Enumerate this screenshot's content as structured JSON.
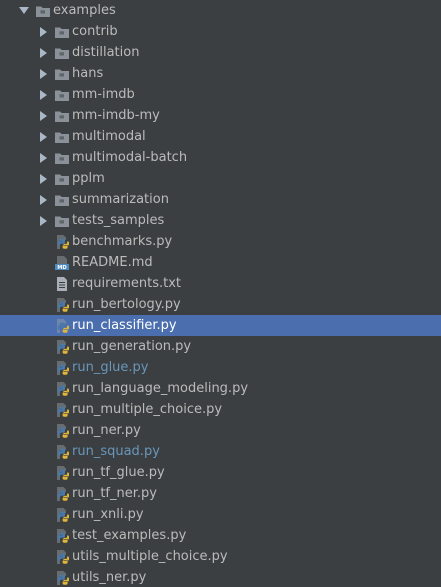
{
  "tree": {
    "root": {
      "label": "examples",
      "icon": "folder-icon",
      "expanded": true
    },
    "items": [
      {
        "label": "contrib",
        "type": "folder",
        "icon": "folder-icon"
      },
      {
        "label": "distillation",
        "type": "folder",
        "icon": "folder-icon"
      },
      {
        "label": "hans",
        "type": "folder",
        "icon": "folder-icon"
      },
      {
        "label": "mm-imdb",
        "type": "folder",
        "icon": "folder-icon"
      },
      {
        "label": "mm-imdb-my",
        "type": "folder",
        "icon": "folder-icon"
      },
      {
        "label": "multimodal",
        "type": "folder",
        "icon": "folder-icon"
      },
      {
        "label": "multimodal-batch",
        "type": "folder",
        "icon": "folder-icon"
      },
      {
        "label": "pplm",
        "type": "folder",
        "icon": "folder-icon"
      },
      {
        "label": "summarization",
        "type": "folder",
        "icon": "folder-icon"
      },
      {
        "label": "tests_samples",
        "type": "folder",
        "icon": "folder-icon"
      },
      {
        "label": "benchmarks.py",
        "type": "python",
        "icon": "python-file-icon"
      },
      {
        "label": "README.md",
        "type": "markdown",
        "icon": "markdown-file-icon",
        "icon_text": "MD"
      },
      {
        "label": "requirements.txt",
        "type": "text",
        "icon": "text-file-icon"
      },
      {
        "label": "run_bertology.py",
        "type": "python",
        "icon": "python-file-icon"
      },
      {
        "label": "run_classifier.py",
        "type": "python",
        "icon": "python-file-icon",
        "selected": true
      },
      {
        "label": "run_generation.py",
        "type": "python",
        "icon": "python-file-icon"
      },
      {
        "label": "run_glue.py",
        "type": "python",
        "icon": "python-file-icon",
        "vcs_modified": true
      },
      {
        "label": "run_language_modeling.py",
        "type": "python",
        "icon": "python-file-icon"
      },
      {
        "label": "run_multiple_choice.py",
        "type": "python",
        "icon": "python-file-icon"
      },
      {
        "label": "run_ner.py",
        "type": "python",
        "icon": "python-file-icon"
      },
      {
        "label": "run_squad.py",
        "type": "python",
        "icon": "python-file-icon",
        "vcs_modified": true
      },
      {
        "label": "run_tf_glue.py",
        "type": "python",
        "icon": "python-file-icon"
      },
      {
        "label": "run_tf_ner.py",
        "type": "python",
        "icon": "python-file-icon"
      },
      {
        "label": "run_xnli.py",
        "type": "python",
        "icon": "python-file-icon"
      },
      {
        "label": "test_examples.py",
        "type": "python",
        "icon": "python-file-icon"
      },
      {
        "label": "utils_multiple_choice.py",
        "type": "python",
        "icon": "python-file-icon"
      },
      {
        "label": "utils_ner.py",
        "type": "python",
        "icon": "python-file-icon"
      }
    ]
  },
  "colors": {
    "background": "#3c3f41",
    "text": "#bbbbbb",
    "selection": "#4b6eaf",
    "vcs_modified_text": "#6897bb",
    "folder": "#8a9199",
    "python_blue": "#4a78a8",
    "python_yellow": "#e0b73a",
    "markdown": "#4d8bbf",
    "text_file": "#a9b0b8"
  }
}
